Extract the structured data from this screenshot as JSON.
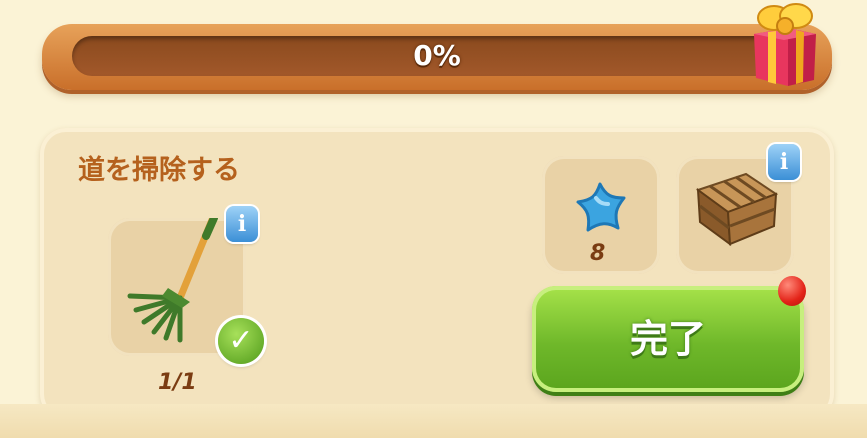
{
  "progress": {
    "percent_label": "0%",
    "fraction": 0.0
  },
  "reward": {
    "icon": "gift-box-icon"
  },
  "task": {
    "title": "道を掃除する",
    "tool": {
      "icon": "rake-icon",
      "count_label": "1/1",
      "completed": true
    },
    "cost": {
      "icon": "blue-star-icon",
      "amount": "8"
    },
    "reward_item": {
      "icon": "wooden-crate-icon"
    },
    "complete_button_label": "完了"
  },
  "info_label": "i",
  "colors": {
    "title": "#b5611d",
    "button_green": "#6fb82a",
    "bar_orange": "#e7a25a",
    "info_blue": "#3b8fd6",
    "notification_red": "#e32318"
  }
}
